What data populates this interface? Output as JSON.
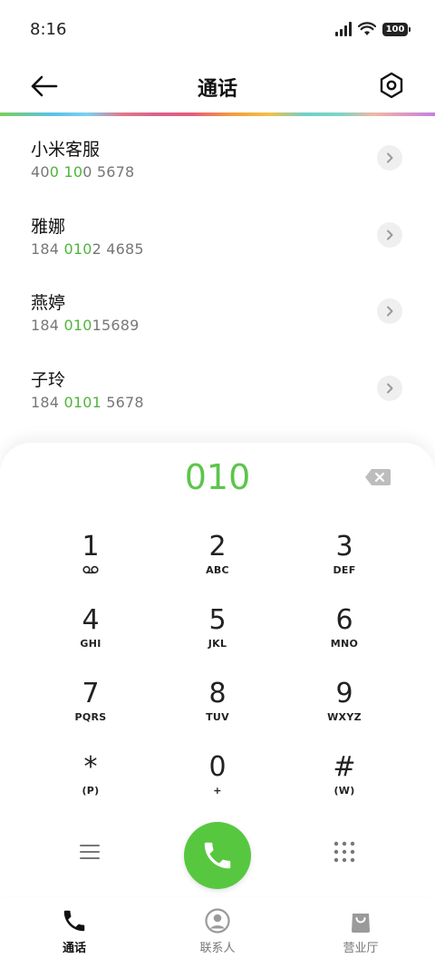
{
  "status_bar": {
    "time": "8:16",
    "battery": "100"
  },
  "header": {
    "title": "通话"
  },
  "contacts": [
    {
      "name": "小米客服",
      "number_parts": [
        "40",
        "0",
        " ",
        "10",
        "0 5678"
      ]
    },
    {
      "name": "雅娜",
      "number_parts": [
        "184 ",
        "010",
        "2 4685"
      ]
    },
    {
      "name": "燕婷",
      "number_parts": [
        "184 ",
        "010",
        "15689"
      ]
    },
    {
      "name": "子玲",
      "number_parts": [
        "184 ",
        "0101",
        " 5678"
      ]
    }
  ],
  "dialer": {
    "entered": "010",
    "keys": [
      {
        "digit": "1",
        "sub": ""
      },
      {
        "digit": "2",
        "sub": "ABC"
      },
      {
        "digit": "3",
        "sub": "DEF"
      },
      {
        "digit": "4",
        "sub": "GHI"
      },
      {
        "digit": "5",
        "sub": "JKL"
      },
      {
        "digit": "6",
        "sub": "MNO"
      },
      {
        "digit": "7",
        "sub": "PQRS"
      },
      {
        "digit": "8",
        "sub": "TUV"
      },
      {
        "digit": "9",
        "sub": "WXYZ"
      },
      {
        "digit": "*",
        "sub": "(P)"
      },
      {
        "digit": "0",
        "sub": "+"
      },
      {
        "digit": "#",
        "sub": "(W)"
      }
    ]
  },
  "nav": {
    "tabs": [
      {
        "label": "通话",
        "icon": "phone-icon"
      },
      {
        "label": "联系人",
        "icon": "contact-icon"
      },
      {
        "label": "营业厅",
        "icon": "shopping-bag-icon"
      }
    ]
  },
  "colors": {
    "accent": "#58c740",
    "highlight": "#4fb53b"
  }
}
